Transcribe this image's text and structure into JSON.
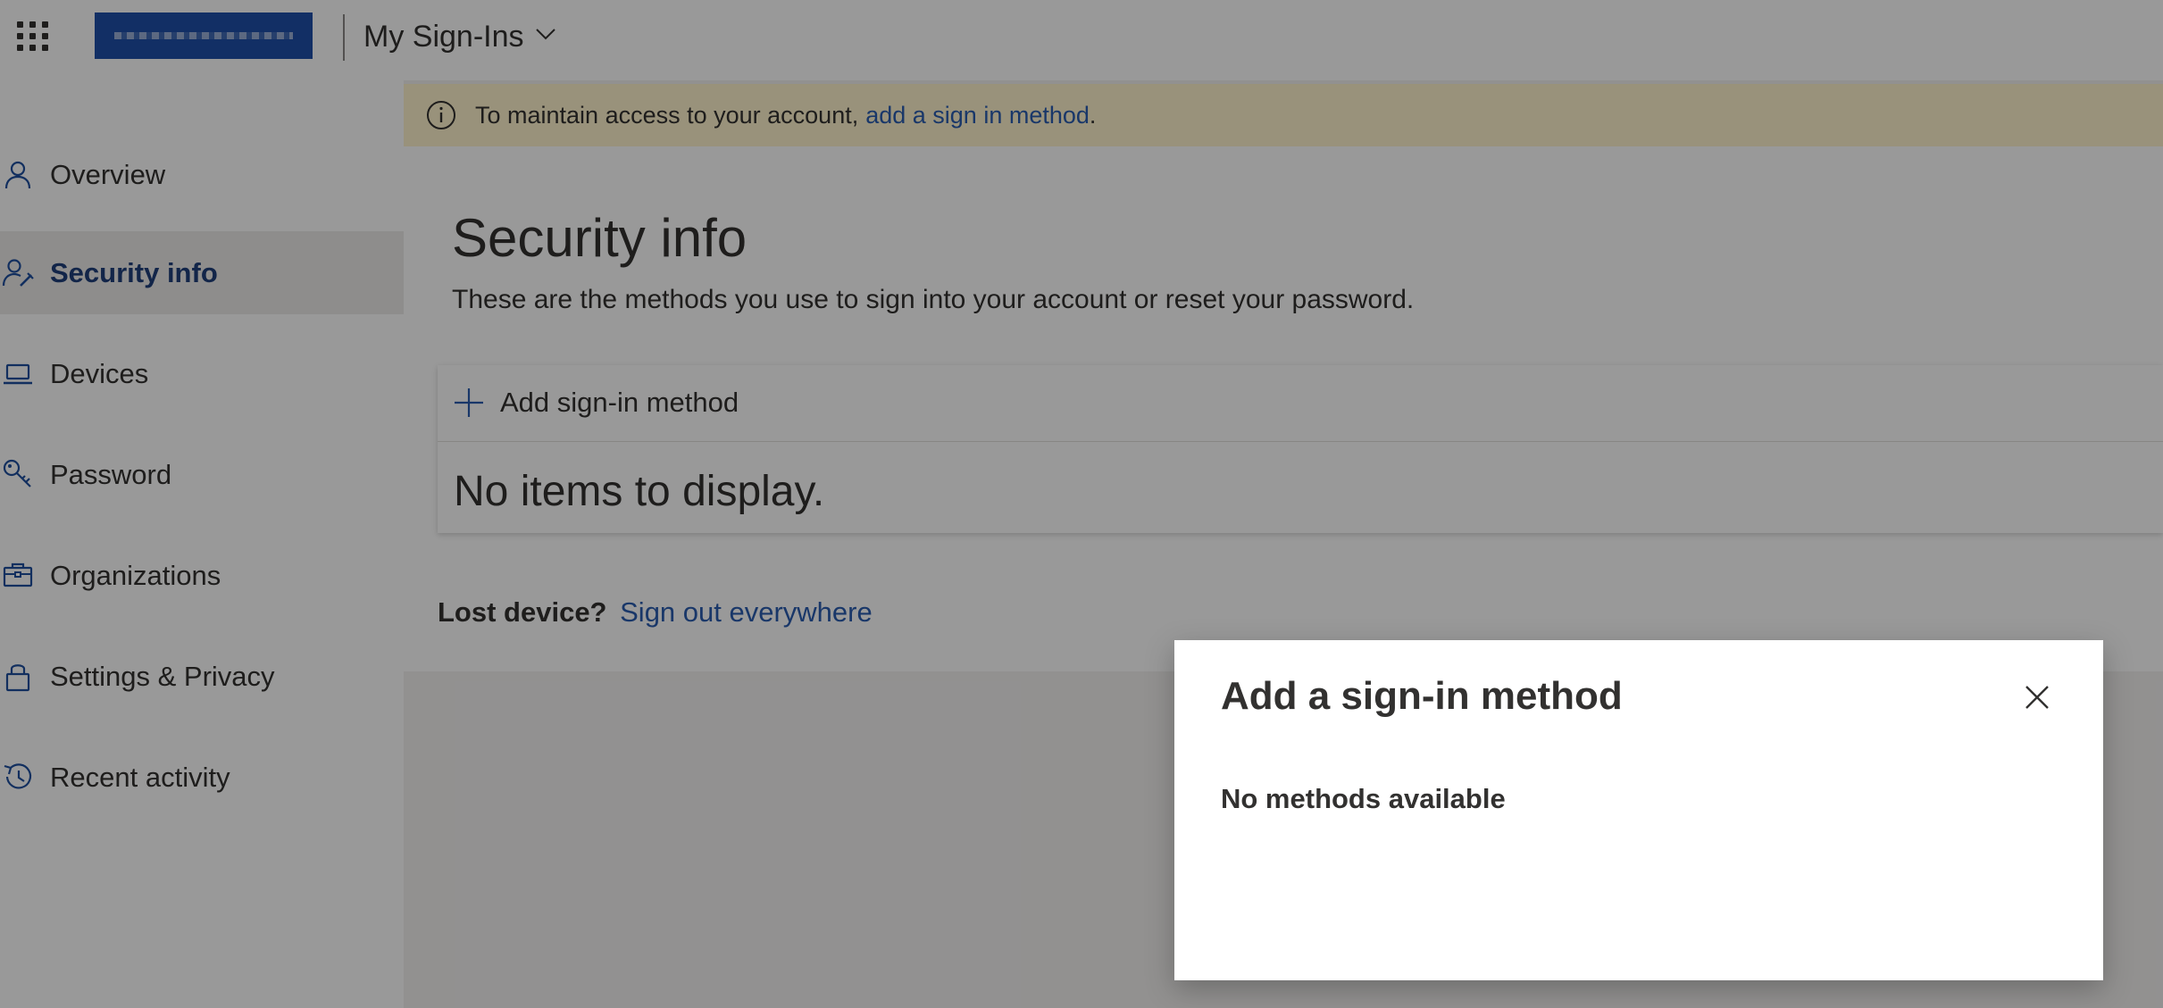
{
  "header": {
    "app_title": "My Sign-Ins",
    "waffle_icon": "app-launcher-icon",
    "logo": "organization-logo (blurred)"
  },
  "sidebar": {
    "items": [
      {
        "label": "Overview",
        "icon": "person-icon",
        "active": false
      },
      {
        "label": "Security info",
        "icon": "person-key-icon",
        "active": true
      },
      {
        "label": "Devices",
        "icon": "laptop-icon",
        "active": false
      },
      {
        "label": "Password",
        "icon": "key-icon",
        "active": false
      },
      {
        "label": "Organizations",
        "icon": "briefcase-icon",
        "active": false
      },
      {
        "label": "Settings & Privacy",
        "icon": "lock-icon",
        "active": false
      },
      {
        "label": "Recent activity",
        "icon": "history-icon",
        "active": false
      }
    ]
  },
  "banner": {
    "text": "To maintain access to your account,",
    "link_text": "add a sign in method",
    "suffix": "."
  },
  "main": {
    "title": "Security info",
    "subtitle": "These are the methods you use to sign into your account or reset your password.",
    "add_method_label": "Add sign-in method",
    "empty_text": "No items to display.",
    "lost_device_label": "Lost device?",
    "sign_out_link": "Sign out everywhere"
  },
  "dialog": {
    "title": "Add a sign-in method",
    "body": "No methods available"
  },
  "colors": {
    "accent": "#1f3f7a",
    "link": "#2a5db0",
    "banner_bg": "#fff4ce",
    "logo_bg": "#1f4fa8"
  }
}
